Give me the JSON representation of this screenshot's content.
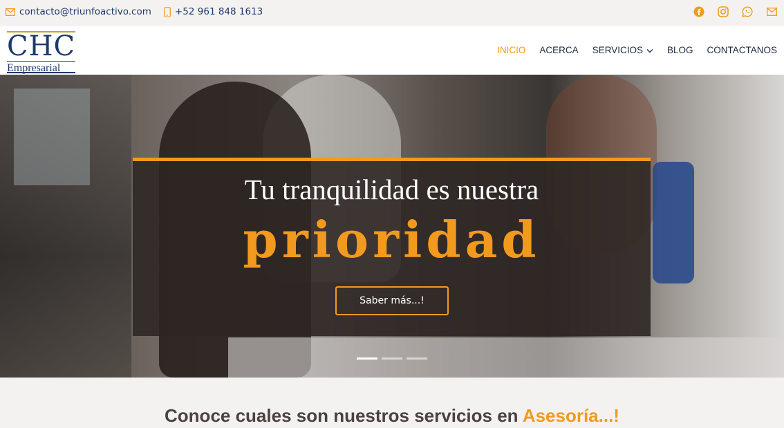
{
  "topbar": {
    "email": "contacto@triunfoactivo.com",
    "phone": "+52 961 848 1613",
    "socials": [
      "facebook-icon",
      "instagram-icon",
      "whatsapp-icon",
      "mail-icon"
    ]
  },
  "logo": {
    "main": "CHC",
    "sub": "Empresarial"
  },
  "nav": {
    "items": [
      {
        "label": "INICIO",
        "active": true
      },
      {
        "label": "ACERCA",
        "active": false
      },
      {
        "label": "SERVICIOS",
        "active": false,
        "dropdown": true
      },
      {
        "label": "BLOG",
        "active": false
      },
      {
        "label": "CONTACTANOS",
        "active": false
      }
    ]
  },
  "hero": {
    "headline": "Tu tranquilidad es nuestra",
    "highlight": "prioridad",
    "button_label": "Saber más...!",
    "slides": 3,
    "active_slide": 1
  },
  "services": {
    "title_prefix": "Conoce cuales son nuestros servicios en ",
    "title_accent": "Asesoría...!"
  },
  "colors": {
    "accent": "#f29a1e",
    "brand": "#1d3a6b",
    "text_dark": "#4b4240"
  }
}
